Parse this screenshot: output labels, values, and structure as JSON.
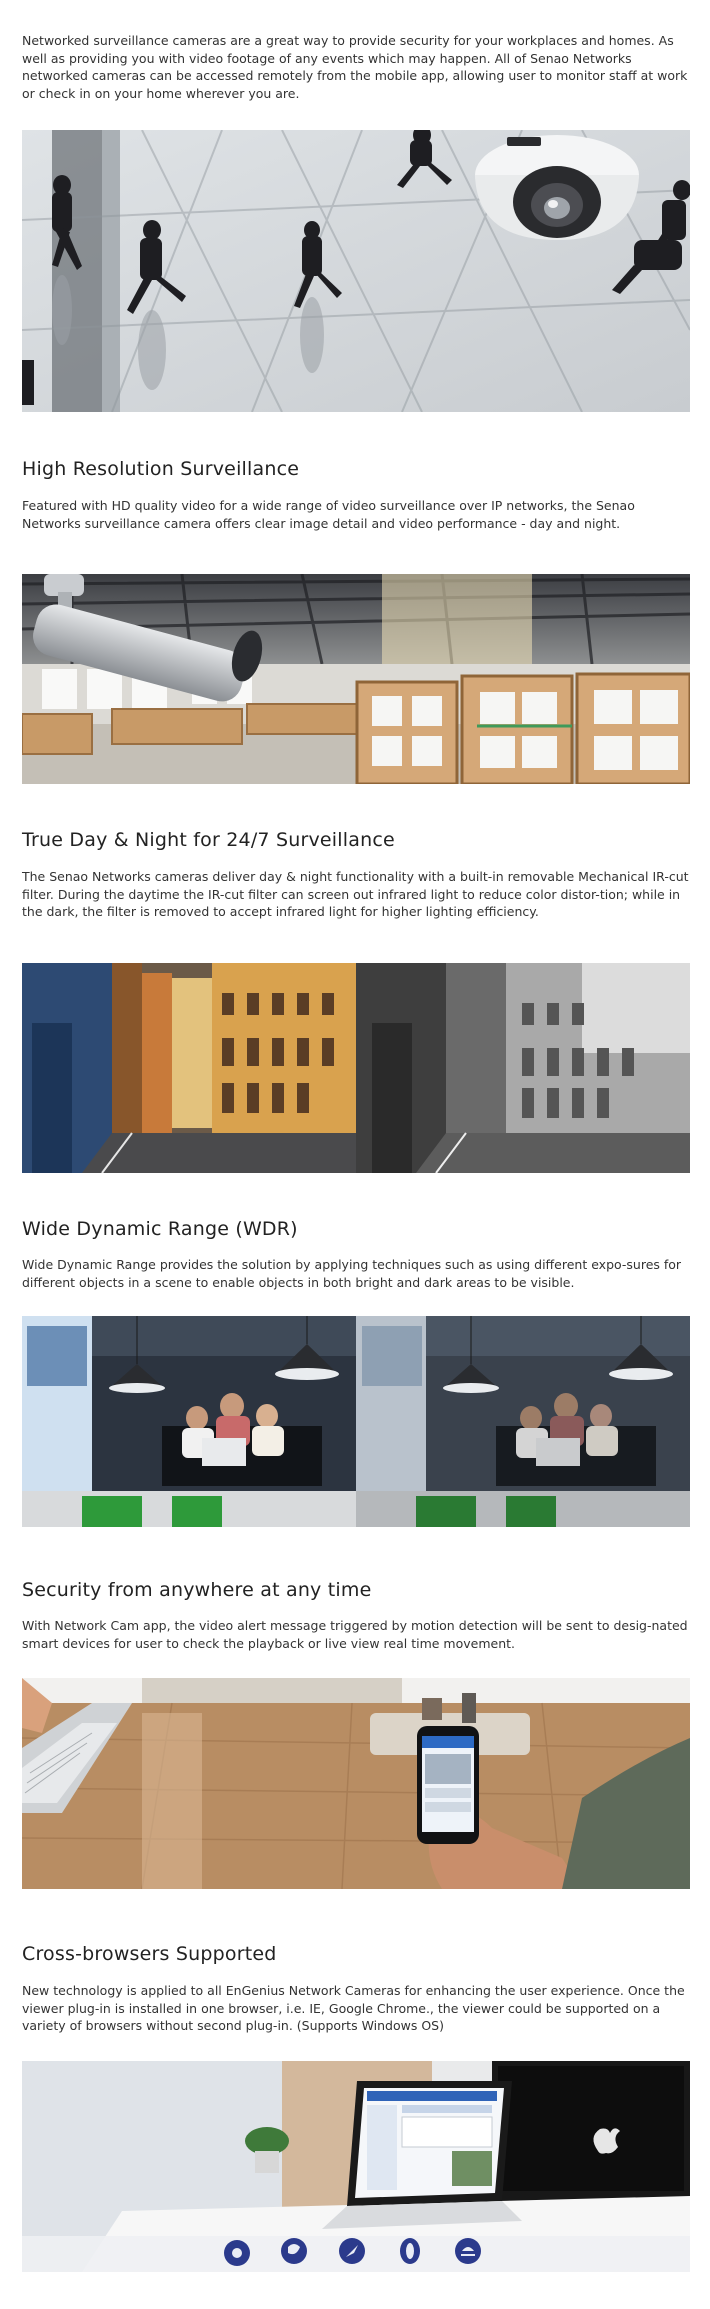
{
  "intro": {
    "text": "Networked surveillance cameras are a great way to provide security for your workplaces and homes. As well as providing you with video footage of any events which may happen. All of Senao Networks networked cameras can be accessed remotely from the mobile app, allowing user to monitor staff at work or check in on your home wherever you are."
  },
  "sections": [
    {
      "title": "High Resolution Surveillance",
      "body": "Featured with HD quality video for a wide range of video surveillance over IP networks, the Senao Networks surveillance camera offers clear image detail and video performance - day and night."
    },
    {
      "title": "True Day & Night for 24/7 Surveillance",
      "body": "The Senao Networks cameras deliver day & night functionality with a built-in removable Mechanical IR-cut filter. During the daytime the IR-cut filter can screen out infrared light to reduce color distor-tion; while in the dark, the filter is removed to accept infrared light for higher lighting efficiency."
    },
    {
      "title": "Wide Dynamic Range (WDR)",
      "body": "Wide Dynamic Range provides the solution by applying techniques such as using different expo-sures for different objects in a scene to enable objects in both bright and dark areas to be visible."
    },
    {
      "title": "Security from anywhere at any time",
      "body": "With Network Cam app, the video alert message triggered by motion detection will be sent to desig-nated smart devices for user to check the playback or live view real time movement."
    },
    {
      "title": "Cross-browsers Supported",
      "body": "New technology is applied to all EnGenius Network Cameras for enhancing the user experience. Once the viewer plug-in is installed in one browser, i.e. IE, Google Chrome., the viewer could be supported on a variety of browsers without second plug-in. (Supports Windows OS)"
    }
  ],
  "images": {
    "lobby": "lobby-with-dome-camera",
    "warehouse": "warehouse-with-bullet-camera",
    "day_night": "street-color-vs-monochrome",
    "wdr": "office-wdr-comparison",
    "mobile": "phone-app-on-desk",
    "browsers": "laptop-with-browser-icons"
  },
  "colors": {
    "text": "#333333",
    "heading": "#222222",
    "background": "#ffffff"
  }
}
